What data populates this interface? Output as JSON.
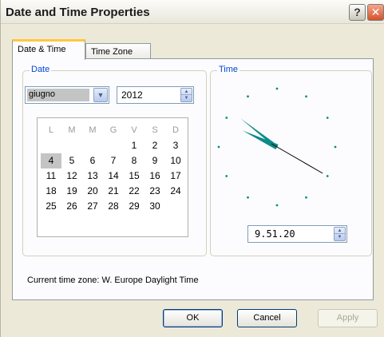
{
  "window": {
    "title": "Date and Time Properties",
    "help_label": "?",
    "close_label": "✕"
  },
  "tabs": [
    {
      "label": "Date & Time",
      "active": true
    },
    {
      "label": "Time Zone",
      "active": false
    }
  ],
  "date_group": {
    "legend": "Date",
    "month_value": "giugno",
    "year_value": "2012",
    "calendar": {
      "weekday_headers": [
        "L",
        "M",
        "M",
        "G",
        "V",
        "S",
        "D"
      ],
      "rows": [
        [
          "",
          "",
          "",
          "",
          "1",
          "2",
          "3"
        ],
        [
          "4",
          "5",
          "6",
          "7",
          "8",
          "9",
          "10"
        ],
        [
          "11",
          "12",
          "13",
          "14",
          "15",
          "16",
          "17"
        ],
        [
          "18",
          "19",
          "20",
          "21",
          "22",
          "23",
          "24"
        ],
        [
          "25",
          "26",
          "27",
          "28",
          "29",
          "30",
          ""
        ]
      ],
      "selected_day": "4"
    }
  },
  "time_group": {
    "legend": "Time",
    "time_value": "9.51.20",
    "clock": {
      "hours": 9,
      "minutes": 51,
      "seconds": 20,
      "hand_color": "#0f8a8a",
      "second_hand_color": "#000000"
    }
  },
  "timezone_text": "Current time zone:  W. Europe Daylight Time",
  "buttons": {
    "ok": "OK",
    "cancel": "Cancel",
    "apply": "Apply"
  },
  "icons": {
    "combo_arrow": "chevron-down-icon",
    "spin_up": "triangle-up-icon",
    "spin_down": "triangle-down-icon"
  },
  "colors": {
    "legend_text": "#0046d5",
    "tab_highlight": "#ffc83c",
    "dialog_bg": "#ece9d8"
  }
}
